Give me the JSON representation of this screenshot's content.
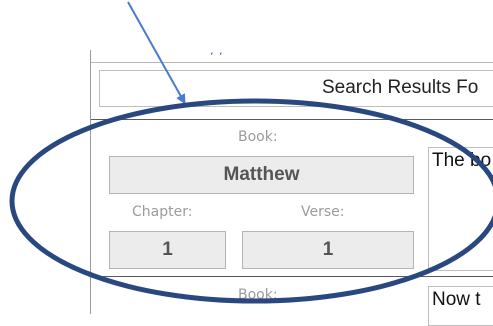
{
  "search": {
    "title": "Search Results Fo"
  },
  "records": [
    {
      "book_label": "Book:",
      "book": "Matthew",
      "chapter_label": "Chapter:",
      "chapter": "1",
      "verse_label": "Verse:",
      "verse": "1",
      "text": "The bo"
    },
    {
      "book_label": "Book:",
      "text": "Now t"
    }
  ],
  "annotation": {
    "color": "#2a4880",
    "arrow_color": "#4a7bd0"
  }
}
